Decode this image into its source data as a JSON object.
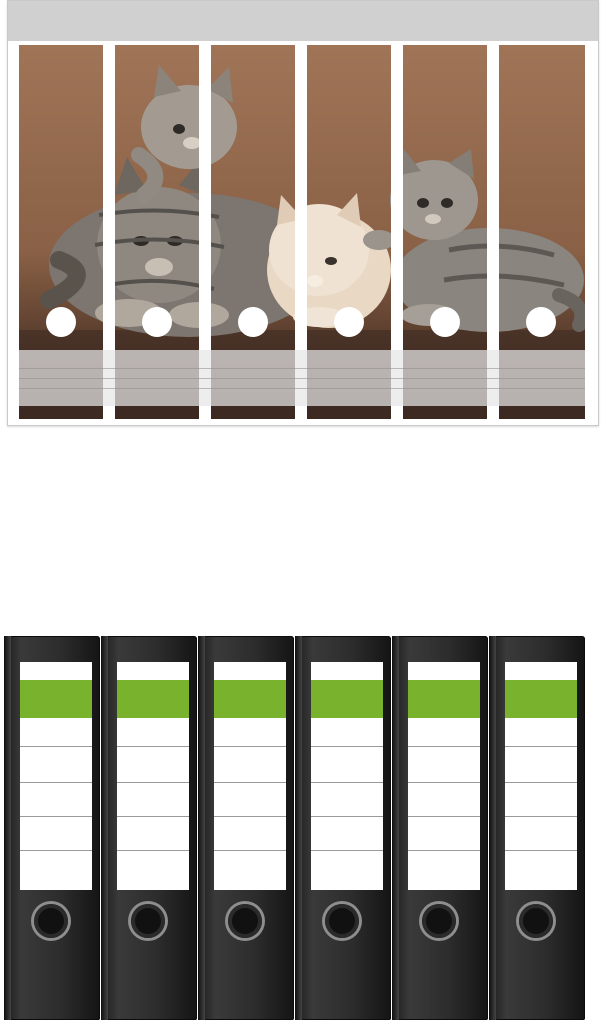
{
  "label_sheet": {
    "photo": {
      "subject": "kittens-photo",
      "background_color": "#8a6146",
      "strip_count": 6
    },
    "header_color": "#d0d0d0"
  },
  "binders": {
    "count": 6,
    "body_color": "#2c2c2c",
    "label_accent_color": "#79b22d"
  }
}
